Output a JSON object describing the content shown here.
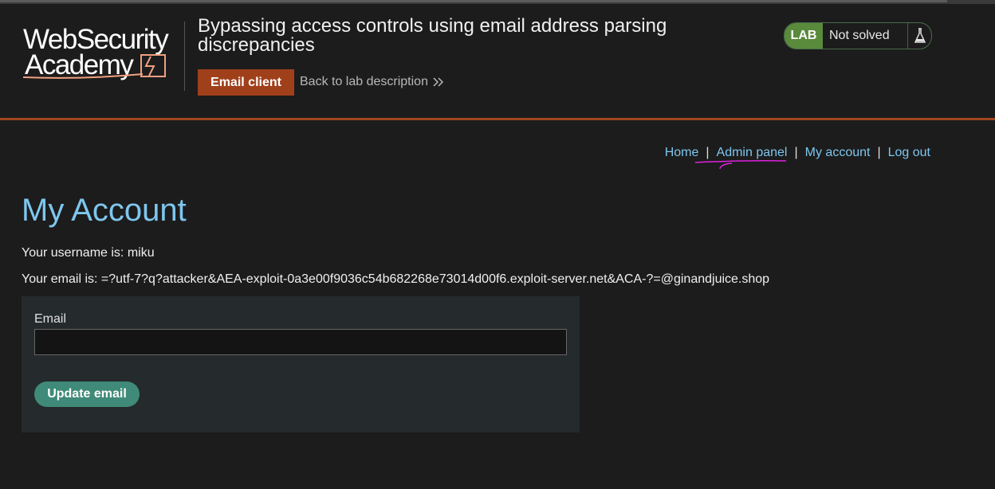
{
  "header": {
    "logo_line1": "WebSecurity",
    "logo_line2": "Academy",
    "lab_title": "Bypassing access controls using email address parsing discrepancies",
    "email_client_label": "Email client",
    "back_link_label": "Back to lab description",
    "status_badge": "LAB",
    "status_text": "Not solved"
  },
  "nav": {
    "home": "Home",
    "admin_panel": "Admin panel",
    "my_account": "My account",
    "log_out": "Log out",
    "separator": "|"
  },
  "main": {
    "title": "My Account",
    "username_line": "Your username is: miku",
    "email_line": "Your email is: =?utf-7?q?attacker&AEA-exploit-0a3e00f9036c54b682268e73014d00f6.exploit-server.net&ACA-?=@ginandjuice.shop"
  },
  "form": {
    "email_label": "Email",
    "email_value": "",
    "update_label": "Update email"
  },
  "icons": {
    "back": "chevron-double-right-icon",
    "flask": "flask-icon",
    "scribble": "pink-underline-annotation"
  },
  "colors": {
    "background": "#1c1c1c",
    "accent_orange": "#a0401b",
    "link_blue": "#7ec6ee",
    "lab_green": "#5a8a3c",
    "button_teal": "#3f8a78",
    "scribble_pink": "#e020e0"
  }
}
